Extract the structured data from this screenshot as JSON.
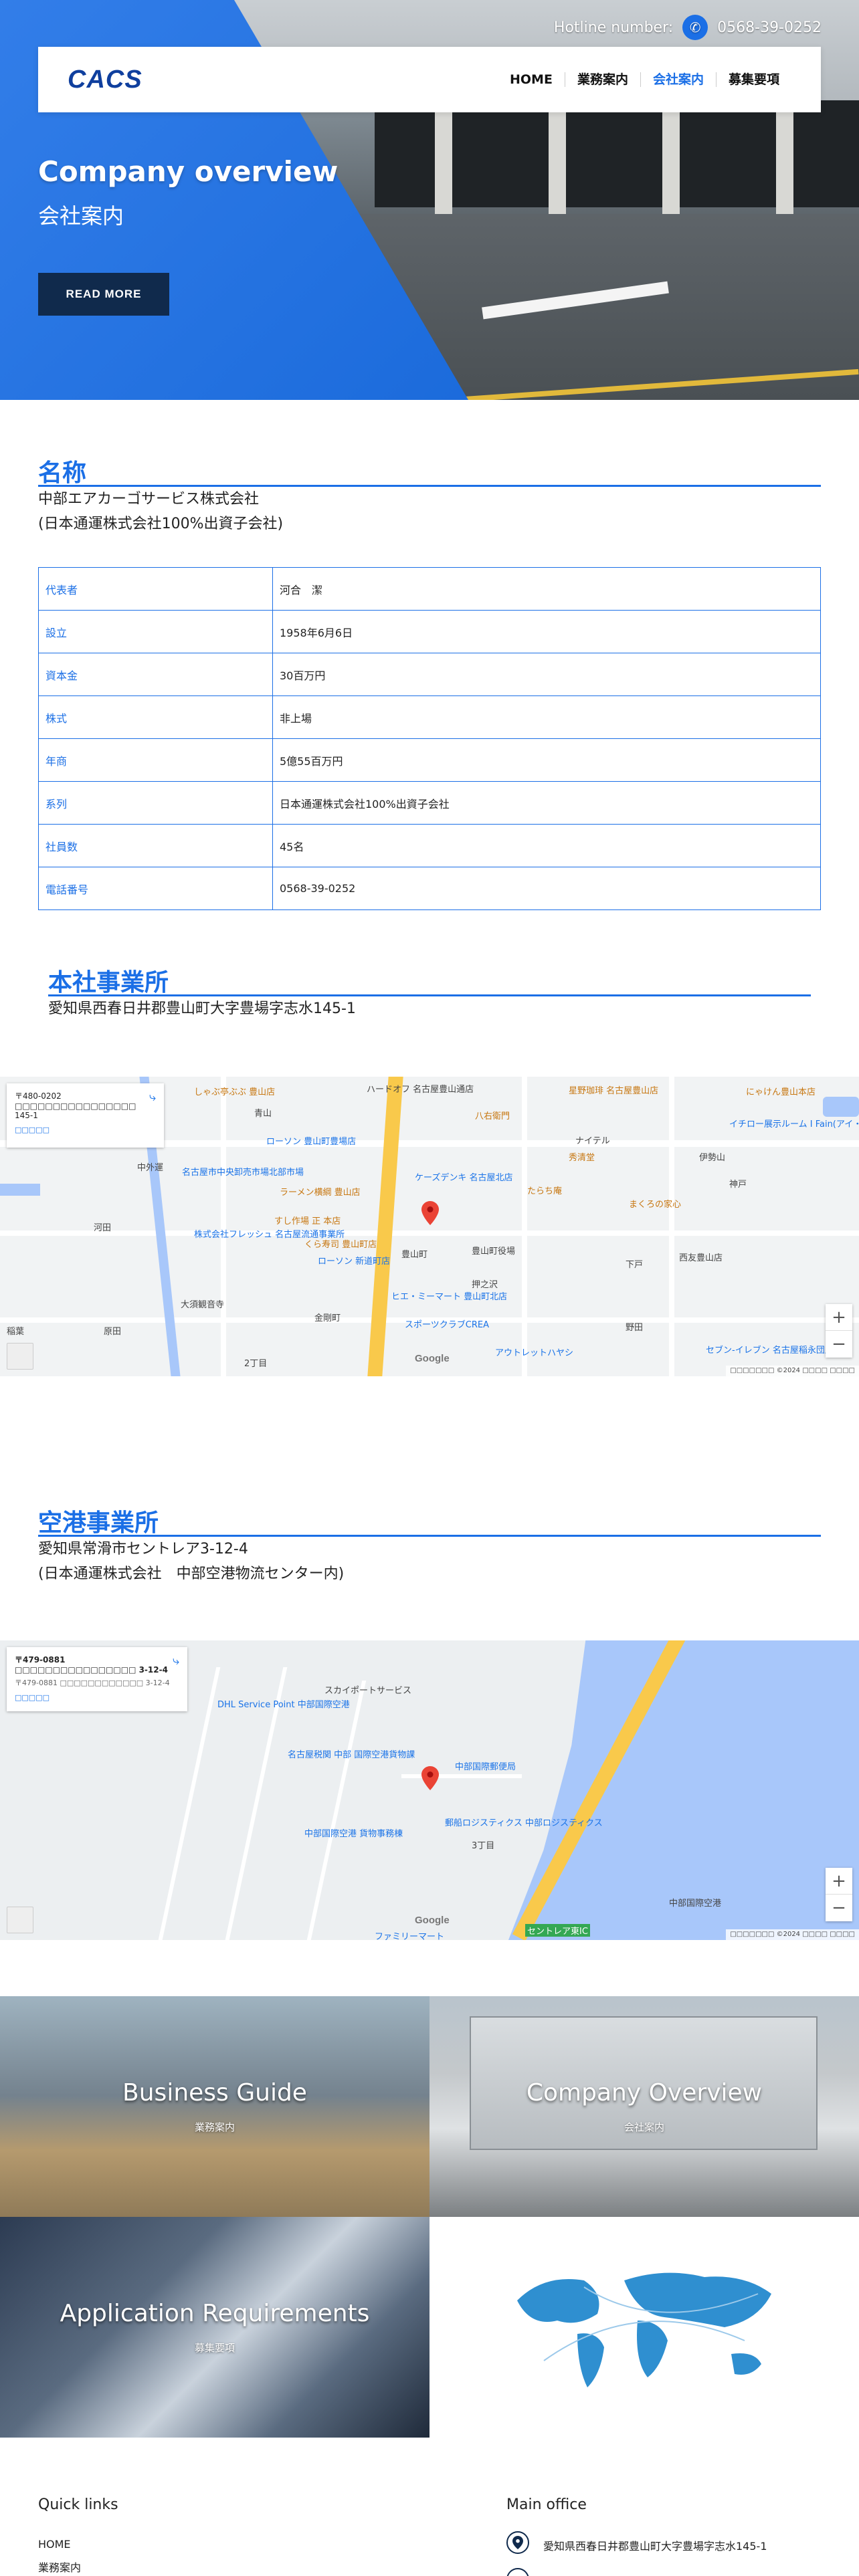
{
  "header": {
    "hotline_label": "Hotline number:",
    "hotline_number": "0568-39-0252",
    "logo": "CACS",
    "nav": [
      {
        "label": "HOME",
        "active": false
      },
      {
        "label": "業務案内",
        "active": false
      },
      {
        "label": "会社案内",
        "active": true
      },
      {
        "label": "募集要項",
        "active": false
      }
    ]
  },
  "hero": {
    "title": "Company overview",
    "subtitle": "会社案内",
    "button": "READ MORE"
  },
  "name_section": {
    "title": "名称",
    "line1": "中部エアカーゴサービス株式会社",
    "line2": "(日本通運株式会社100%出資子会社)"
  },
  "company_table": [
    {
      "key": "代表者",
      "value": "河合　潔"
    },
    {
      "key": "設立",
      "value": "1958年6月6日"
    },
    {
      "key": "資本金",
      "value": "30百万円"
    },
    {
      "key": "株式",
      "value": "非上場"
    },
    {
      "key": "年商",
      "value": "5億55百万円"
    },
    {
      "key": "系列",
      "value": "日本通運株式会社100%出資子会社"
    },
    {
      "key": "社員数",
      "value": "45名"
    },
    {
      "key": "電話番号",
      "value": "0568-39-0252"
    }
  ],
  "head_office": {
    "title": "本社事業所",
    "address": "愛知県西春日井郡豊山町大字豊場字志水145-1"
  },
  "map1": {
    "card_line1": "〒480-0202 □□□□□□□□□□□□□□□□ 145-1",
    "card_link": "□□□□□",
    "labels": [
      "しゃぶ亭ぶぶ 豊山店",
      "ハードオフ 名古屋豊山通店",
      "星野珈琲 名古屋豊山店",
      "にゃけん豊山本店",
      "イチロー展示ルーム I Fain(アイ・ファイン)",
      "八右衛門",
      "名古屋市中央卸売市場北部市場",
      "ローソン 豊山町豊場店",
      "ラーメン横綱 豊山店",
      "ケーズデンキ 名古屋北店",
      "秀清堂",
      "まくろの家心",
      "すし作場 正 本店",
      "くら寿司 豊山町店",
      "ローソン 新道町店",
      "株式会社フレッシュ 名古屋流通事業所",
      "たらち庵",
      "西友豊山店",
      "豊山町役場",
      "ヒエ・ミーマート 豊山町北店",
      "スポーツクラブCREA",
      "アウトレットハヤシ",
      "セブン-イレブン 名古屋稲永団店",
      "大須観音寺",
      "金剛町",
      "豊山町",
      "青山",
      "伊勢山",
      "神戸",
      "下戸",
      "野田",
      "2丁目",
      "押之沢",
      "原田",
      "中外運",
      "河田",
      "ナイテル",
      "稲葉"
    ],
    "google": "Google",
    "attrib": "□□□□□□□  ©2024  □□□□  □□□□"
  },
  "airport_office": {
    "title": "空港事業所",
    "address": "愛知県常滑市セントレア3-12-4",
    "note": "(日本通運株式会社　中部空港物流センター内)"
  },
  "map2": {
    "card_line1": "〒479-0881 □□□□□□□□□□□□□□□□ 3-12-4",
    "card_line2": "〒479-0881 □□□□□□□□□□□□ 3-12-4",
    "card_link": "□□□□□",
    "labels": [
      "スカイポートサービス",
      "DHL Service Point 中部国際空港",
      "名古屋税関 中部 国際空港貨物課",
      "中部国際郵便局",
      "中部国際空港 貨物事務棟",
      "郵船ロジスティクス 中部ロジスティクス",
      "3丁目",
      "ファミリーマート",
      "セントレア東IC",
      "中部国際空港",
      "Google"
    ],
    "google": "Google",
    "attrib": "□□□□□□□  ©2024  □□□□  □□□□"
  },
  "tiles": [
    {
      "title": "Business Guide",
      "sub": "業務案内"
    },
    {
      "title": "Company Overview",
      "sub": "会社案内"
    },
    {
      "title": "Application Requirements",
      "sub": "募集要項"
    },
    {
      "title": "",
      "sub": ""
    }
  ],
  "footer": {
    "quick_links_title": "Quick links",
    "links": [
      "HOME",
      "業務案内"
    ],
    "main_office_title": "Main office",
    "main_office_address": "愛知県西春日井郡豊山町大字豊場字志水145-1"
  },
  "colors": {
    "accent": "#1b6fe6",
    "navy": "#102a4c",
    "logo": "#0f3f9e"
  }
}
